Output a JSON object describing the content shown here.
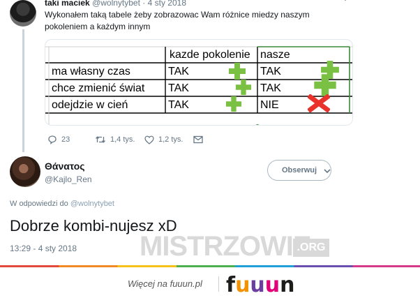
{
  "tweet": {
    "author_name": "taki maciek",
    "author_handle": "@wolnytybet",
    "date": "· 4 sty 2018",
    "text": "Wykonałem taką tabele żeby zobrazowac Wam różnice miedzy naszym pokoleniem a każdym innym",
    "table": {
      "header": [
        "",
        "kazde pokolenie",
        "nasze"
      ],
      "rows": [
        {
          "label": "ma własny czas",
          "col1": "TAK",
          "col1_mark": "plus-icon",
          "col2": "TAK",
          "col2_mark": "plus-icon"
        },
        {
          "label": "chce zmienić świat",
          "col1": "TAK",
          "col1_mark": "plus-icon",
          "col2": "TAK",
          "col2_mark": "plus-icon"
        },
        {
          "label": "odejdzie w cień",
          "col1": "TAK",
          "col1_mark": "plus-icon",
          "col2": "NIE",
          "col2_mark": "cross-icon"
        }
      ],
      "colors": {
        "plus": "#7ac143",
        "cross": "#e8322b",
        "grid": "#000000"
      }
    },
    "actions": {
      "replies": "23",
      "retweets": "1,4 tys.",
      "likes": "1,2 tys."
    }
  },
  "reply": {
    "author_name": "Θάνατος",
    "author_handle": "@Kajlo_Ren",
    "follow_label": "Obserwuj",
    "reply_to_prefix": "W odpowiedzi do",
    "reply_to_handle": "@wolnytybet",
    "text": "Dobrze kombi-nujesz xD",
    "timestamp": "13:29 - 4 sty 2018"
  },
  "watermark": {
    "main": "MISTRZOWIE",
    "suffix": ".ORG"
  },
  "footer": {
    "link_text": "Więcej na fuuun.pl",
    "logo_letters": [
      "f",
      "u",
      "u",
      "u",
      "n"
    ],
    "logo_colors": [
      "#1d1d1b",
      "#f39200",
      "#6b3fa0",
      "#e2007a",
      "#1d1d1b"
    ]
  },
  "colors": {
    "text_primary": "#14171a",
    "text_secondary": "#657786",
    "thread_line": "#c9d3db"
  }
}
